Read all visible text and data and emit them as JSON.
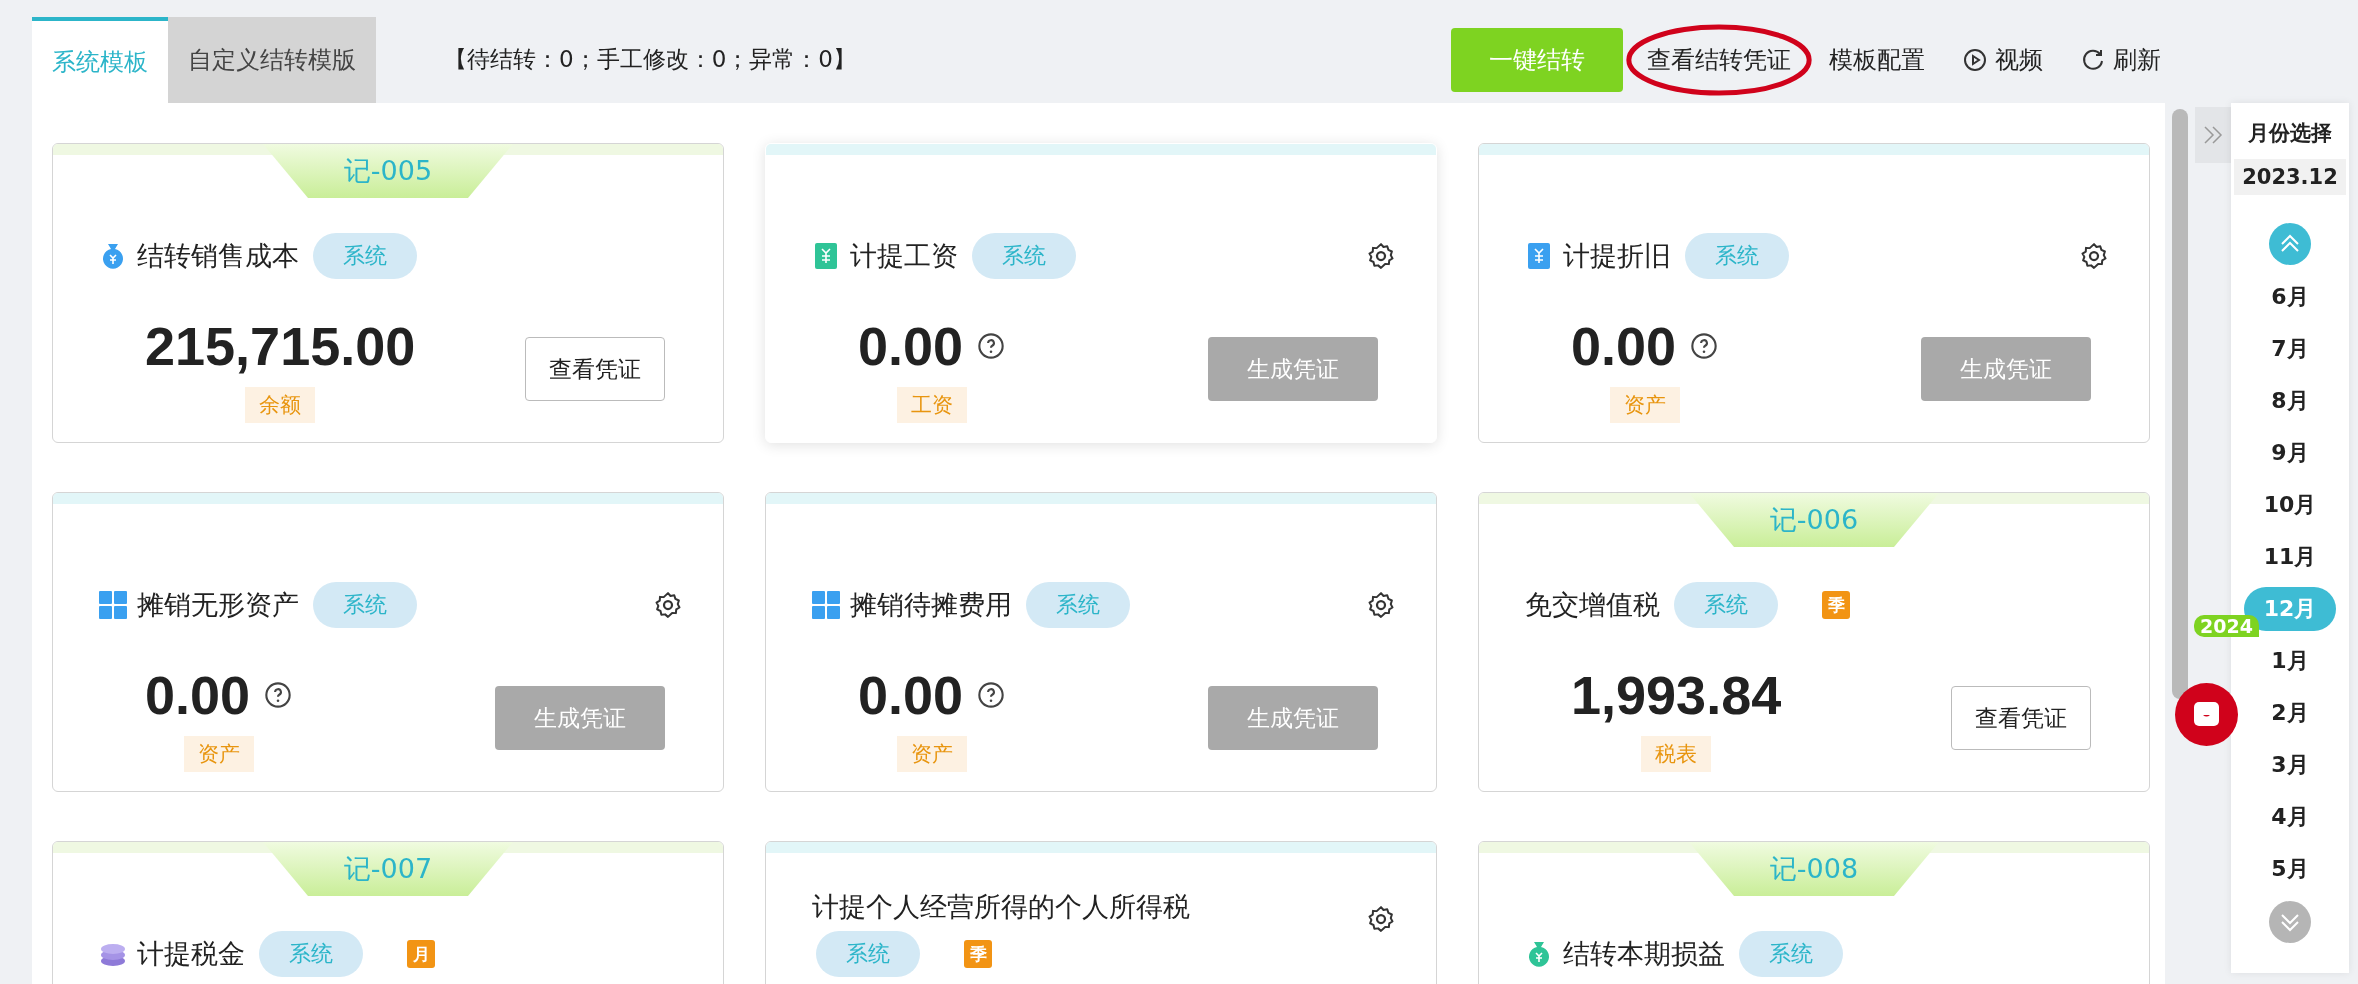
{
  "tabs": [
    {
      "label": "系统模板",
      "selected": true
    },
    {
      "label": "自定义结转模版",
      "selected": false
    }
  ],
  "status": "【待结转：0；手工修改：0；异常：0】",
  "toolbar": [
    {
      "kind": "primary",
      "label": "一键结转"
    },
    {
      "kind": "circled",
      "label": "查看结转凭证"
    },
    {
      "kind": "plain",
      "label": "模板配置"
    },
    {
      "kind": "video",
      "label": "视频"
    },
    {
      "kind": "refresh",
      "label": "刷新"
    }
  ],
  "cards": [
    {
      "kind": "inline",
      "voucher": "记-005",
      "title": "结转销售成本",
      "tag": "系统",
      "amount": "215,715.00",
      "help": false,
      "amount_label": "余额",
      "button": {
        "label": "查看凭证",
        "disabled": false
      },
      "settings": false,
      "hovered": false
    },
    {
      "kind": "inline",
      "title": "计提工资",
      "tag": "系统",
      "amount": "0.00",
      "help": true,
      "amount_label": "工资",
      "button": {
        "label": "生成凭证",
        "disabled": true
      },
      "settings": true,
      "hovered": true
    },
    {
      "kind": "inline",
      "title": "计提折旧",
      "tag": "系统",
      "amount": "0.00",
      "help": true,
      "amount_label": "资产",
      "button": {
        "label": "生成凭证",
        "disabled": true
      },
      "settings": true,
      "hovered": false
    },
    {
      "kind": "inline",
      "title": "摊销无形资产",
      "tag": "系统",
      "amount": "0.00",
      "help": true,
      "amount_label": "资产",
      "button": {
        "label": "生成凭证",
        "disabled": true
      },
      "settings": true,
      "hovered": false
    },
    {
      "kind": "inline",
      "title": "摊销待摊费用",
      "tag": "系统",
      "amount": "0.00",
      "help": true,
      "amount_label": "资产",
      "button": {
        "label": "生成凭证",
        "disabled": true
      },
      "settings": true,
      "hovered": false
    },
    {
      "kind": "inline",
      "voucher": "记-006",
      "title": "免交增值税",
      "tag": "系统",
      "period": "季",
      "amount": "1,993.84",
      "help": false,
      "amount_label": "税表",
      "button": {
        "label": "查看凭证",
        "disabled": false
      },
      "settings": false,
      "hovered": false
    },
    {
      "kind": "inline",
      "voucher": "记-007",
      "title": "计提税金",
      "tag": "系统",
      "period": "月",
      "settings": false,
      "hovered": false
    },
    {
      "kind": "stacked",
      "title": "计提个人经营所得的个人所得税",
      "tag": "系统",
      "period": "季",
      "settings": true,
      "hovered": false
    },
    {
      "kind": "inline",
      "voucher": "记-008",
      "title": "结转本期损益",
      "tag": "系统",
      "settings": false,
      "hovered": false
    }
  ],
  "month_panel": {
    "title": "月份选择",
    "current": "2023.12",
    "months": [
      {
        "label": "6月",
        "selected": false
      },
      {
        "label": "7月",
        "selected": false
      },
      {
        "label": "8月",
        "selected": false
      },
      {
        "label": "9月",
        "selected": false
      },
      {
        "label": "10月",
        "selected": false
      },
      {
        "label": "11月",
        "selected": false
      },
      {
        "label": "12月",
        "selected": true
      },
      {
        "label": "1月",
        "selected": false,
        "year_badge": "2024"
      },
      {
        "label": "2月",
        "selected": false
      },
      {
        "label": "3月",
        "selected": false
      },
      {
        "label": "4月",
        "selected": false
      },
      {
        "label": "5月",
        "selected": false
      }
    ]
  }
}
